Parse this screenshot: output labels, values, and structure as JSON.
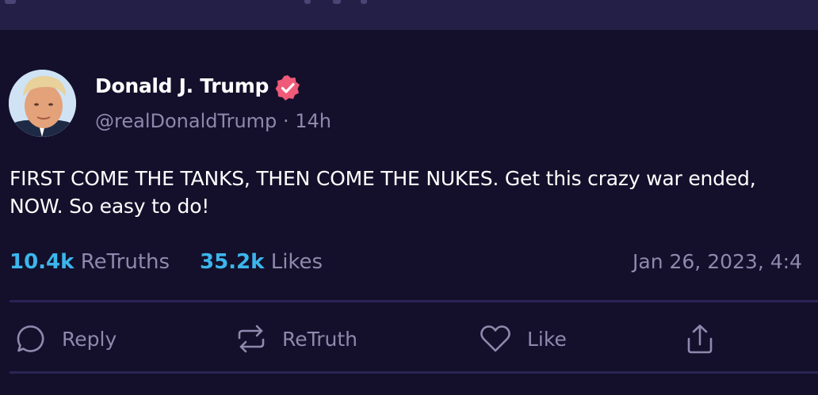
{
  "author": {
    "name": "Donald J. Trump",
    "handle": "@realDonaldTrump",
    "separator": "·",
    "age": "14h",
    "avatar_icon": "profile-photo",
    "verified_icon": "verified-badge-icon"
  },
  "post": {
    "text": "FIRST COME THE TANKS, THEN COME THE NUKES. Get this crazy war ended, NOW. So easy to do!"
  },
  "stats": {
    "retruths_count": "10.4k",
    "retruths_label": "ReTruths",
    "likes_count": "35.2k",
    "likes_label": "Likes"
  },
  "timestamp": "Jan 26, 2023, 4:4",
  "actions": {
    "reply": "Reply",
    "retruth": "ReTruth",
    "like": "Like"
  },
  "colors": {
    "background": "#14102b",
    "accent_counts": "#3cb6ec",
    "muted_text": "#8e89ad",
    "verified_badge": "#ef5a79"
  }
}
